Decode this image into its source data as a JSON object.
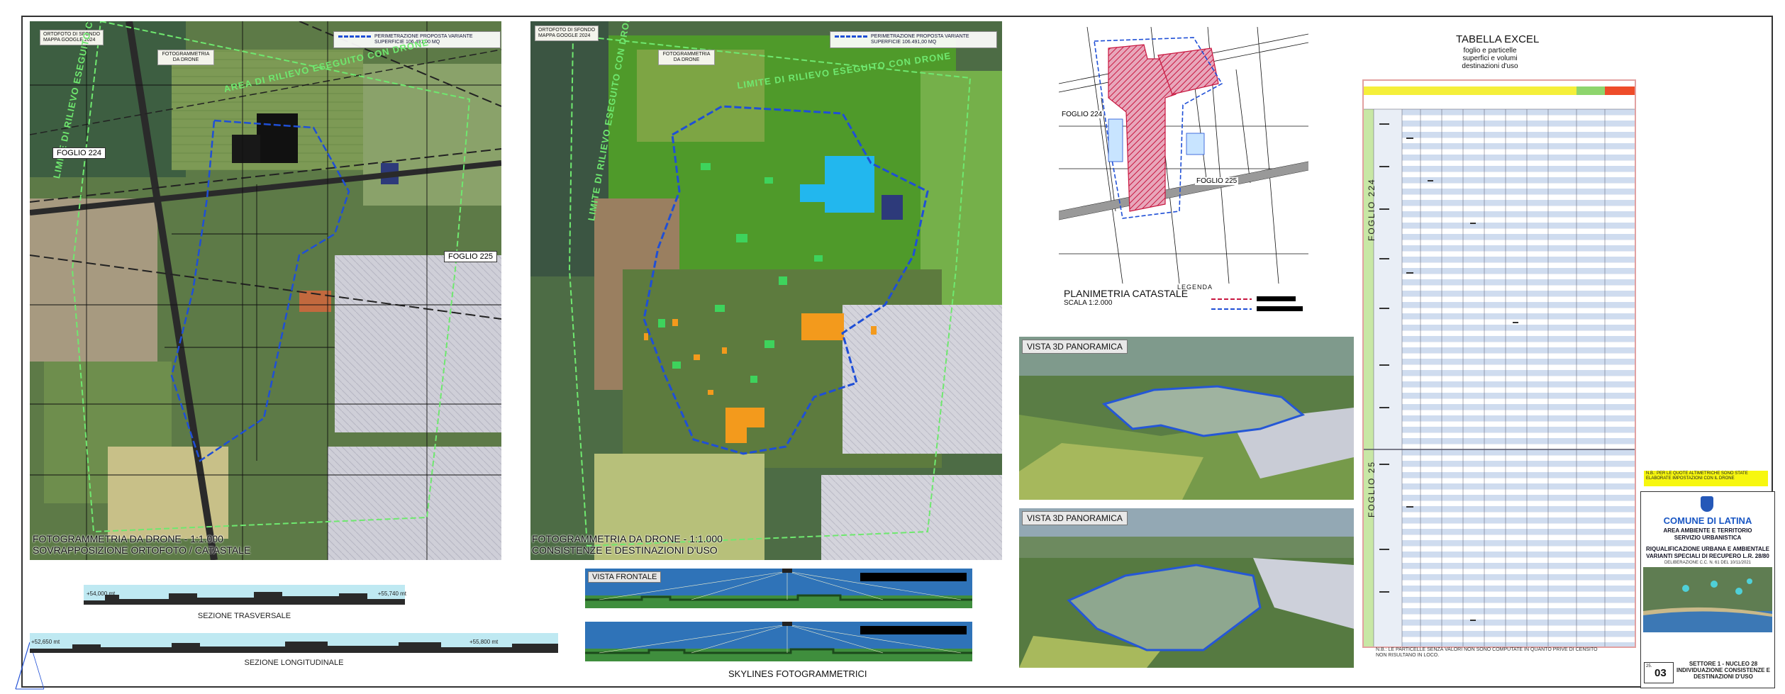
{
  "map_left": {
    "tag": "ORTOFOTO DI SFONDO\nMAPPA GOOGLE 2024",
    "drone_tag": "FOTOGRAMMETRIA\nDA DRONE",
    "legend_line1": "PERIMETRAZIONE PROPOSTA VARIANTE",
    "legend_line2": "SUPERFICIE 106.491,00 MQ",
    "green_label_1": "AREA DI RILIEVO ESEGUITO CON DRONE",
    "green_label_2": "LIMITE DI RILIEVO ESEGUITO CON DRONE",
    "foglio_224": "FOGLIO 224",
    "foglio_225": "FOGLIO 225",
    "caption_1": "FOTOGRAMMETRIA DA DRONE - 1:1.000",
    "caption_2": "SOVRAPPOSIZIONE ORTOFOTO / CATASTALE"
  },
  "map_right": {
    "tag": "ORTOFOTO DI SFONDO\nMAPPA GOOGLE 2024",
    "drone_tag": "FOTOGRAMMETRIA\nDA DRONE",
    "legend_line1": "PERIMETRAZIONE PROPOSTA VARIANTE",
    "legend_line2": "SUPERFICIE 106.491,00 MQ",
    "green_label_1": "LIMITE DI RILIEVO ESEGUITO CON DRONE",
    "green_label_2": "LIMITE DI RILIEVO ESEGUITO CON DRONE",
    "caption_1": "FOTOGRAMMETRIA DA DRONE - 1:1.000",
    "caption_2": "CONSISTENZE E DESTINAZIONI D'USO"
  },
  "sections": {
    "transversal_label": "SEZIONE TRASVERSALE",
    "transversal_left": "+54,000 mt",
    "transversal_right": "+55,740 mt",
    "longitudinal_label": "SEZIONE LONGITUDINALE",
    "longitudinal_left": "+52,650 mt",
    "longitudinal_right": "+55,800 mt"
  },
  "catastale": {
    "foglio_224": "FOGLIO 224",
    "foglio_225": "FOGLIO 225",
    "title": "PLANIMETRIA CATASTALE",
    "scale": "SCALA 1:2.000",
    "legenda": "LEGENDA"
  },
  "views": {
    "panoramic_1": "VISTA 3D PANORAMICA",
    "panoramic_2": "VISTA 3D PANORAMICA",
    "frontal": "VISTA FRONTALE",
    "skylines_title": "SKYLINES FOTOGRAMMETRICI"
  },
  "excel": {
    "title": "TABELLA EXCEL",
    "sub_1": "foglio e particelle",
    "sub_2": "superfici e volumi",
    "sub_3": "destinazioni d'uso",
    "foglio_224": "FOGLIO 224",
    "foglio_25": "FOGLIO 25",
    "note": "N.B.: LE PARTICELLE SENZA VALORI NON SONO COMPUTATE IN QUANTO PRIVE DI CENSITO NON RISULTANO IN LOCO."
  },
  "titleblock": {
    "yellow_note": "N.B.: PER LE QUOTE ALTIMETRICHE SONO STATE ELABORATE IMPOSTAZIONI CON IL DRONE",
    "city": "COMUNE DI LATINA",
    "dept_1": "AREA AMBIENTE E TERRITORIO",
    "dept_2": "SERVIZIO URBANISTICA",
    "project_1": "RIQUALIFICAZIONE URBANA E AMBIENTALE",
    "project_2": "VARIANTI SPECIALI DI RECUPERO L.R. 28/80",
    "delibera": "DELIBERAZIONE C.C. N. 61 DEL 10/11/2021",
    "sheet_prefix": "25.",
    "sheet_number": "03",
    "desc_1": "SETTORE 1 - NUCLEO 28",
    "desc_2": "INDIVIDUAZIONE CONSISTENZE E",
    "desc_3": "DESTINAZIONI D'USO"
  },
  "colors": {
    "perimeter": "#1f4fd6",
    "drone_limit": "#6fe86f",
    "catastale_hatch": "#c8163f",
    "excel_border": "#e2a1a1",
    "title_city": "#1a57c4",
    "yellow_note": "#f7f70f"
  }
}
